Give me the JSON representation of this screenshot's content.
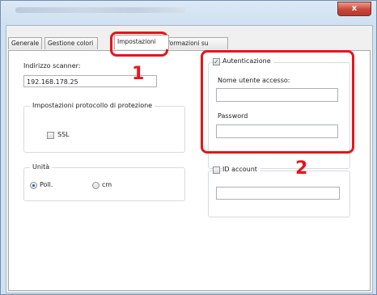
{
  "window": {
    "close_glyph": "x"
  },
  "tabs": [
    {
      "label": "Generale"
    },
    {
      "label": "Gestione colori"
    },
    {
      "label": "Impostazioni"
    },
    {
      "label": "Informazioni su"
    }
  ],
  "settings": {
    "scanner_address_label": "Indirizzo scanner:",
    "scanner_address_value": "192.168.178.25",
    "protocol_group_title": "Impostazioni protocollo di protezione",
    "ssl_label": "SSL",
    "ssl_checked": false,
    "units_group_title": "Unità",
    "unit_inch_label": "Poll.",
    "unit_cm_label": "cm",
    "unit_selected": "Poll.",
    "auth_label": "Autenticazione",
    "auth_checked": true,
    "auth_check_glyph": "✓",
    "username_label": "Nome utente accesso:",
    "username_value": "",
    "password_label": "Password",
    "password_value": "",
    "id_account_label": "ID account",
    "id_account_checked": false,
    "id_account_value": ""
  },
  "callouts": [
    {
      "number": "1",
      "color": "#e8141c"
    },
    {
      "number": "2",
      "color": "#e8141c"
    }
  ]
}
